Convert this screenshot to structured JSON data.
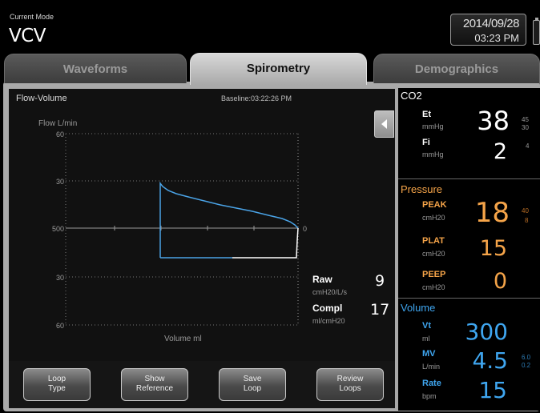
{
  "header": {
    "mode_label": "Current Mode",
    "mode_value": "VCV",
    "date": "2014/09/28",
    "time": "03:23 PM"
  },
  "tabs": [
    {
      "label": "Waveforms",
      "active": false
    },
    {
      "label": "Spirometry",
      "active": true
    },
    {
      "label": "Demographics",
      "active": false
    }
  ],
  "plot": {
    "title": "Flow-Volume",
    "baseline": "Baseline:03:22:26 PM",
    "y_label": "Flow  L/min",
    "x_label": "Volume  ml",
    "y_ticks": [
      "60",
      "30",
      "500",
      "30",
      "60"
    ],
    "x_end_tick": "0"
  },
  "measurements": {
    "raw": {
      "label": "Raw",
      "unit": "cmH20/L/s",
      "value": "9"
    },
    "compl": {
      "label": "Compl",
      "unit": "ml/cmH20",
      "value": "17"
    }
  },
  "buttons": [
    {
      "line1": "Loop",
      "line2": "Type"
    },
    {
      "line1": "Show",
      "line2": "Reference"
    },
    {
      "line1": "Save",
      "line2": "Loop"
    },
    {
      "line1": "Review",
      "line2": "Loops"
    }
  ],
  "co2": {
    "title": "CO2",
    "et": {
      "label": "Et",
      "unit": "mmHg",
      "value": "38",
      "high": "45",
      "low": "30"
    },
    "fi": {
      "label": "Fi",
      "unit": "mmHg",
      "value": "2",
      "high": "4"
    }
  },
  "pressure": {
    "title": "Pressure",
    "peak": {
      "label": "PEAK",
      "unit": "cmH20",
      "value": "18",
      "high": "40",
      "low": "8"
    },
    "plat": {
      "label": "PLAT",
      "unit": "cmH20",
      "value": "15"
    },
    "peep": {
      "label": "PEEP",
      "unit": "cmH20",
      "value": "0"
    }
  },
  "volume": {
    "title": "Volume",
    "vt": {
      "label": "Vt",
      "unit": "ml",
      "value": "300"
    },
    "mv": {
      "label": "MV",
      "unit": "L/min",
      "value": "4.5",
      "high": "6.0",
      "low": "0.2"
    },
    "rate": {
      "label": "Rate",
      "unit": "bpm",
      "value": "15"
    }
  },
  "colors": {
    "pressure": "#f5a449",
    "volume": "#3fa6f0",
    "loop_inspiratory": "#4aa3e6",
    "loop_expiratory": "#ffffff"
  },
  "icons": {
    "collapse": "chevron-left-icon",
    "battery": "battery-icon"
  }
}
